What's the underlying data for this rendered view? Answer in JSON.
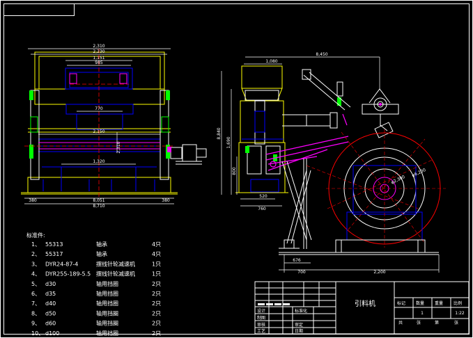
{
  "front_view": {
    "dims": {
      "overall_width": "2,310",
      "inner_width": "2,230",
      "width_1": "1,151",
      "width_2": "985",
      "center_width": "770",
      "roller_width": "2,150",
      "lower_span": "1,320",
      "left_offset": "380",
      "bottom_width": "8,051",
      "base_width": "8,710",
      "right_offset": "380",
      "side_height": "2,310"
    }
  },
  "side_view": {
    "dims": {
      "overall_length": "8,450",
      "top_width": "1,080",
      "total_height": "8,840",
      "height_1": "1,690",
      "height_2": "800",
      "lower_1": "520",
      "lower_2": "760",
      "pulley_dia": "φ6,200",
      "drum_dia": "φ2,300",
      "support_w": "676",
      "base_w": "700",
      "base_length": "2,200"
    }
  },
  "parts_list": {
    "title": "标准件:",
    "rows": [
      {
        "no": "1、",
        "code": "55313",
        "name": "轴承",
        "qty": "4只"
      },
      {
        "no": "2、",
        "code": "55317",
        "name": "轴承",
        "qty": "4只"
      },
      {
        "no": "3、",
        "code": "DYR24-87-4",
        "name": "摆线针轮减速机",
        "qty": "1只"
      },
      {
        "no": "4、",
        "code": "DYR255-189-5.5",
        "name": "摆线针轮减速机",
        "qty": "1只"
      },
      {
        "no": "5、",
        "code": "d30",
        "name": "轴用挡圈",
        "qty": "2只"
      },
      {
        "no": "6、",
        "code": "d35",
        "name": "轴用挡圈",
        "qty": "2只"
      },
      {
        "no": "7、",
        "code": "d40",
        "name": "轴用挡圈",
        "qty": "2只"
      },
      {
        "no": "8、",
        "code": "d50",
        "name": "轴用挡圈",
        "qty": "2只"
      },
      {
        "no": "9、",
        "code": "d60",
        "name": "轴用挡圈",
        "qty": "2只"
      },
      {
        "no": "10、",
        "code": "d100",
        "name": "轴用挡圈",
        "qty": "2只"
      }
    ]
  },
  "title_block": {
    "drawing_title": "引料机",
    "left_labels": [
      "设计",
      "制图",
      "审核",
      "工艺"
    ],
    "mid_labels": [
      "标准化",
      "审定",
      "日期"
    ],
    "header": [
      "标记",
      "数量",
      "重量",
      "比例"
    ],
    "qty_value": "1",
    "scale_value": "1:22",
    "sheet_labels": [
      "共",
      "张",
      "第",
      "张"
    ]
  },
  "colors": {
    "background": "#000000",
    "frame": "#ffffff",
    "outline": "#ffff00",
    "part": "#0000ff",
    "highlight": "#ff00ff",
    "center_line": "#ff0000",
    "green": "#00ff00",
    "cyan": "#00ffff"
  }
}
